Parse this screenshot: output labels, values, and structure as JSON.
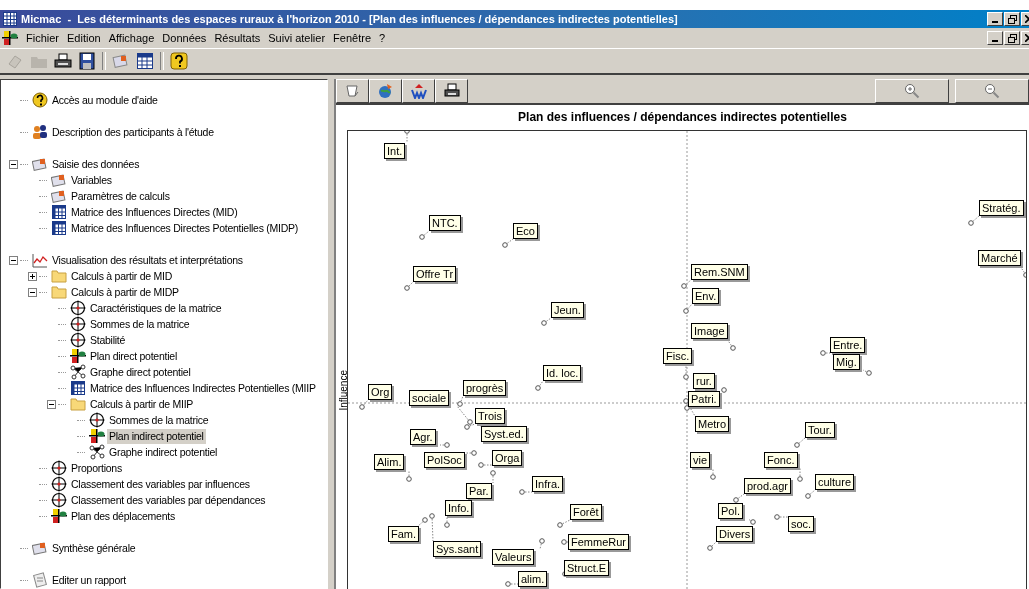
{
  "window": {
    "title": "Micmac  -  Les déterminants des espaces ruraux à l'horizon 2010 - [Plan des influences / dépendances indirectes potentielles]"
  },
  "menu": [
    "Fichier",
    "Edition",
    "Affichage",
    "Données",
    "Résultats",
    "Suivi atelier",
    "Fenêtre",
    "?"
  ],
  "tree": [
    {
      "label": "Accès au module d'aide",
      "kind": "help",
      "selected": false
    },
    {
      "label": "Description des participants à l'étude",
      "kind": "people",
      "selected": false
    },
    {
      "label": "Saisie des données",
      "kind": "data",
      "selected": false,
      "expanded": true,
      "children": [
        {
          "label": "Variables",
          "kind": "data",
          "selected": false
        },
        {
          "label": "Paramètres de calculs",
          "kind": "data",
          "selected": false
        },
        {
          "label": "Matrice des Influences Directes (MID)",
          "kind": "table",
          "selected": false
        },
        {
          "label": "Matrice des Influences Directes Potentielles (MIDP)",
          "kind": "table",
          "selected": false
        }
      ]
    },
    {
      "label": "Visualisation des résultats et interprétations",
      "kind": "chart",
      "selected": false,
      "expanded": true,
      "children": [
        {
          "label": "Calculs à partir de MID",
          "kind": "folder",
          "selected": false,
          "expanded": false
        },
        {
          "label": "Calculs à partir de MIDP",
          "kind": "folder",
          "selected": false,
          "expanded": true,
          "children": [
            {
              "label": "Caractéristiques de la matrice",
              "kind": "target",
              "selected": false
            },
            {
              "label": "Sommes de la matrice",
              "kind": "target",
              "selected": false
            },
            {
              "label": "Stabilité",
              "kind": "target",
              "selected": false
            },
            {
              "label": "Plan direct potentiel",
              "kind": "plan",
              "selected": false
            },
            {
              "label": "Graphe direct potentiel",
              "kind": "graph",
              "selected": false
            },
            {
              "label": "Matrice des Influences Indirectes Potentielles (MIIP",
              "kind": "table",
              "selected": false
            },
            {
              "label": "Calculs à partir de MIIP",
              "kind": "folder",
              "selected": false,
              "expanded": true,
              "children": [
                {
                  "label": "Sommes de la matrice",
                  "kind": "target",
                  "selected": false
                },
                {
                  "label": "Plan indirect potentiel",
                  "kind": "plan",
                  "selected": true
                },
                {
                  "label": "Graphe indirect potentiel",
                  "kind": "graph",
                  "selected": false
                }
              ]
            }
          ]
        },
        {
          "label": "Proportions",
          "kind": "target",
          "selected": false
        },
        {
          "label": "Classement des variables par influences",
          "kind": "target",
          "selected": false
        },
        {
          "label": "Classement des variables par dépendances",
          "kind": "target",
          "selected": false
        },
        {
          "label": "Plan des déplacements",
          "kind": "plan",
          "selected": false
        }
      ]
    },
    {
      "label": "Synthèse générale",
      "kind": "data",
      "selected": false
    },
    {
      "label": "Editer un rapport",
      "kind": "report",
      "selected": false
    }
  ],
  "chart": {
    "title": "Plan des influences / dépendances indirectes potentielles",
    "ylabel": "Influence",
    "points": [
      {
        "label": "Int."
      },
      {
        "label": "NTC."
      },
      {
        "label": "Eco"
      },
      {
        "label": "Stratég."
      },
      {
        "label": "Marché"
      },
      {
        "label": "Offre Tr"
      },
      {
        "label": "Rem.SNM"
      },
      {
        "label": "Env."
      },
      {
        "label": "Jeun."
      },
      {
        "label": "Image"
      },
      {
        "label": "Fisc."
      },
      {
        "label": "Entre."
      },
      {
        "label": "Org"
      },
      {
        "label": "sociale"
      },
      {
        "label": "progrès"
      },
      {
        "label": "Id. loc."
      },
      {
        "label": "Mig."
      },
      {
        "label": "rur."
      },
      {
        "label": "Patri."
      },
      {
        "label": "Trois"
      },
      {
        "label": "Agr."
      },
      {
        "label": "Syst.ed."
      },
      {
        "label": "Metro"
      },
      {
        "label": "Tour."
      },
      {
        "label": "Alim."
      },
      {
        "label": "PolSoc"
      },
      {
        "label": "Orga"
      },
      {
        "label": "vie"
      },
      {
        "label": "Fonc."
      },
      {
        "label": "Par."
      },
      {
        "label": "Infra."
      },
      {
        "label": "prod.agr"
      },
      {
        "label": "culture"
      },
      {
        "label": "Info."
      },
      {
        "label": "Forêt"
      },
      {
        "label": "Pol."
      },
      {
        "label": "Fam."
      },
      {
        "label": "Sys.sant"
      },
      {
        "label": "FemmeRur"
      },
      {
        "label": "Divers"
      },
      {
        "label": "soc."
      },
      {
        "label": "Valeurs"
      },
      {
        "label": "alim."
      },
      {
        "label": "Struct.E"
      }
    ]
  }
}
